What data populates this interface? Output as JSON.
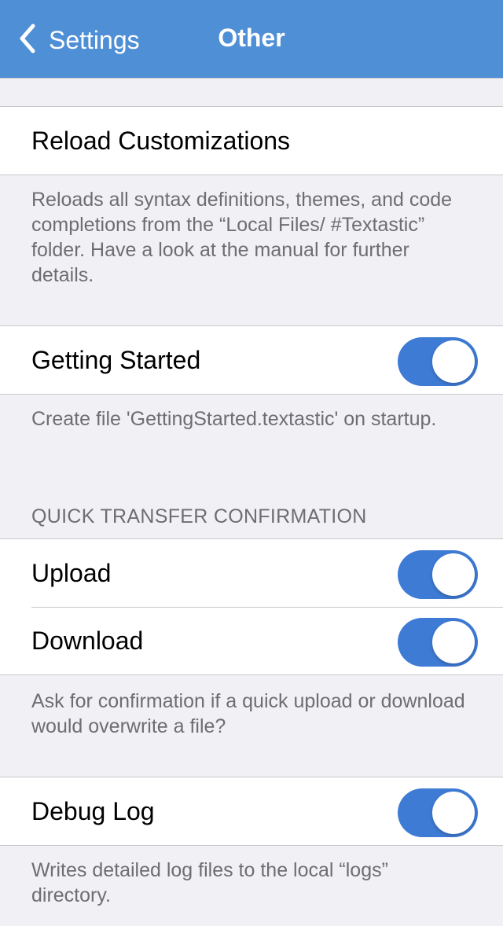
{
  "nav": {
    "back_label": "Settings",
    "title": "Other"
  },
  "reload": {
    "label": "Reload Customizations",
    "footer": "Reloads all syntax definitions, themes, and code completions from the “Local Files/ #Textastic” folder. Have a look at the manual for further details."
  },
  "getting_started": {
    "label": "Getting Started",
    "enabled": true,
    "footer": "Create file 'GettingStarted.textastic' on startup."
  },
  "quick_transfer": {
    "header": "QUICK TRANSFER CONFIRMATION",
    "upload_label": "Upload",
    "upload_enabled": true,
    "download_label": "Download",
    "download_enabled": true,
    "footer": "Ask for confirmation if a quick upload or download would overwrite a file?"
  },
  "debug": {
    "label": "Debug Log",
    "enabled": true,
    "footer": "Writes detailed log files to the local “logs” directory."
  },
  "colors": {
    "nav_bar": "#4f8fd6",
    "toggle_on": "#3e7bd5",
    "background": "#f0f0f5"
  },
  "icons": {
    "back": "chevron-left-icon"
  }
}
